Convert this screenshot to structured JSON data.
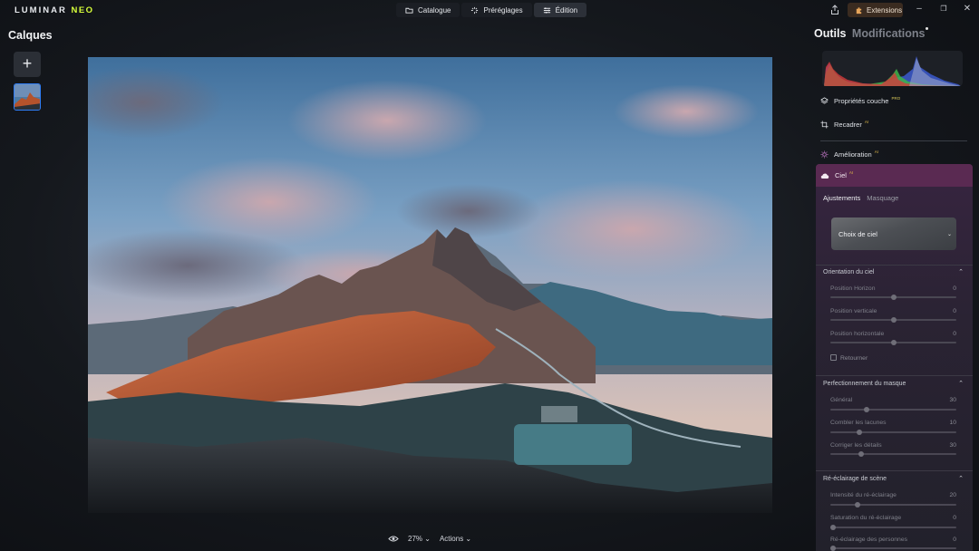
{
  "app": {
    "name_prefix": "LUMINAR",
    "name_suffix": "NEO"
  },
  "modes": [
    {
      "label": "Catalogue",
      "icon": "folder-icon"
    },
    {
      "label": "Préréglages",
      "icon": "presets-icon"
    },
    {
      "label": "Édition",
      "icon": "sliders-icon"
    }
  ],
  "active_mode": "Édition",
  "extensions_label": "Extensions",
  "left": {
    "title": "Calques",
    "add_label": "+"
  },
  "bottom": {
    "zoom": "27%",
    "actions": "Actions"
  },
  "right": {
    "tab_tools": "Outils",
    "tab_edits": "Modifications",
    "tools": [
      {
        "label": "Propriétés couche",
        "badge": "PRO",
        "icon": "layers-icon"
      },
      {
        "label": "Recadrer",
        "badge": "AI",
        "icon": "crop-icon"
      },
      {
        "label": "Amélioration",
        "badge": "AI",
        "icon": "sparkle-icon"
      }
    ],
    "sky": {
      "title": "Ciel",
      "badge": "AI",
      "subtab_adjust": "Ajustements",
      "subtab_mask": "Masquage",
      "choose_label": "Choix de ciel",
      "sections": [
        {
          "title": "Orientation du ciel",
          "sliders": [
            {
              "label": "Position Horizon",
              "value": "0"
            },
            {
              "label": "Position verticale",
              "value": "0"
            },
            {
              "label": "Position horizontale",
              "value": "0"
            }
          ],
          "checkbox": "Retourner"
        },
        {
          "title": "Perfectionnement du masque",
          "sliders": [
            {
              "label": "Général",
              "value": "30"
            },
            {
              "label": "Combler les lacunes",
              "value": "10"
            },
            {
              "label": "Corriger les détails",
              "value": "30"
            }
          ]
        },
        {
          "title": "Ré-éclairage de scène",
          "sliders": [
            {
              "label": "Intensité du ré-éclairage",
              "value": "20"
            },
            {
              "label": "Saturation du ré-éclairage",
              "value": "0"
            },
            {
              "label": "Ré-éclairage des personnes",
              "value": "0"
            }
          ]
        }
      ]
    }
  },
  "colors": {
    "accent_blue": "#2f7ef6",
    "neo_yellow": "#d8ff3a",
    "sky_panel": "#5a2a52",
    "extensions_bg": "#3a2b20"
  }
}
